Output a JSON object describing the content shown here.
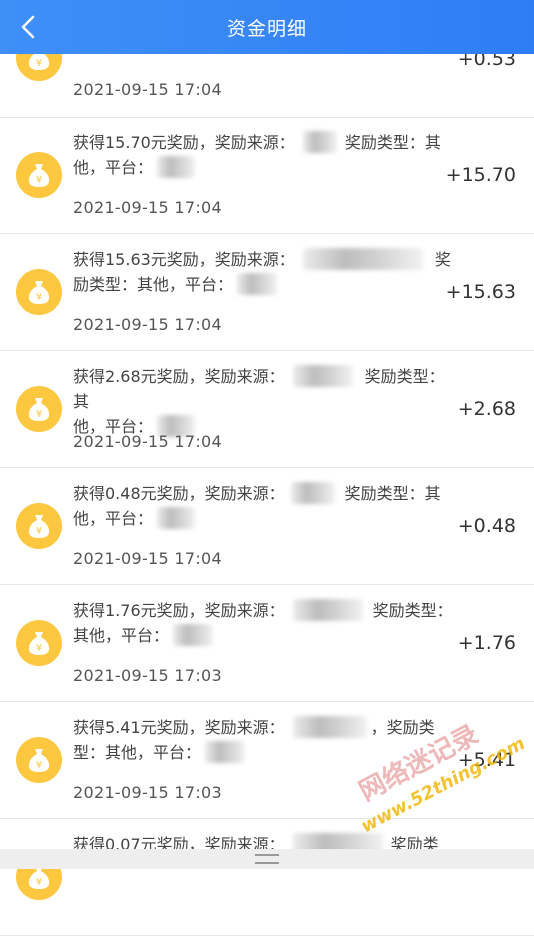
{
  "header": {
    "title": "资金明细",
    "back_icon": "chevron-left-icon"
  },
  "colors": {
    "header": "#3580f6",
    "coin": "#fdc840",
    "divider": "#e6e6e6"
  },
  "records": [
    {
      "line1": "",
      "line2": "",
      "time": "2021-09-15 17:04",
      "amount": "+0.53"
    },
    {
      "line1": "获得15.70元奖励，奖励来源：",
      "line1_after": "奖励类型：其",
      "line2": "他，平台：",
      "time": "2021-09-15 17:04",
      "amount": "+15.70"
    },
    {
      "line1": "获得15.63元奖励，奖励来源：",
      "line1_after": "奖",
      "line2": "励类型：其他，平台：",
      "time": "2021-09-15 17:04",
      "amount": "+15.63"
    },
    {
      "line1": "获得2.68元奖励，奖励来源：",
      "line1_after": "奖励类型：其",
      "line2": "他，平台：",
      "time": "2021-09-15 17:04",
      "amount": "+2.68"
    },
    {
      "line1": "获得0.48元奖励，奖励来源：",
      "line1_after": "奖励类型：其",
      "line2": "他，平台：",
      "time": "2021-09-15 17:04",
      "amount": "+0.48"
    },
    {
      "line1": "获得1.76元奖励，奖励来源：",
      "line1_after": "奖励类型：",
      "line2": "其他，平台：",
      "time": "2021-09-15 17:03",
      "amount": "+1.76"
    },
    {
      "line1": "获得5.41元奖励，奖励来源：",
      "line1_after": "，奖励类",
      "line2": "型：其他，平台：",
      "time": "2021-09-15 17:03",
      "amount": "+5.41"
    },
    {
      "line1": "获得0.07元奖励，奖励来源：",
      "line1_after": "奖励类",
      "line2": "",
      "time": "",
      "amount": ""
    }
  ],
  "watermark": {
    "text": "网络迷记录",
    "url": "www.52thing.com"
  }
}
